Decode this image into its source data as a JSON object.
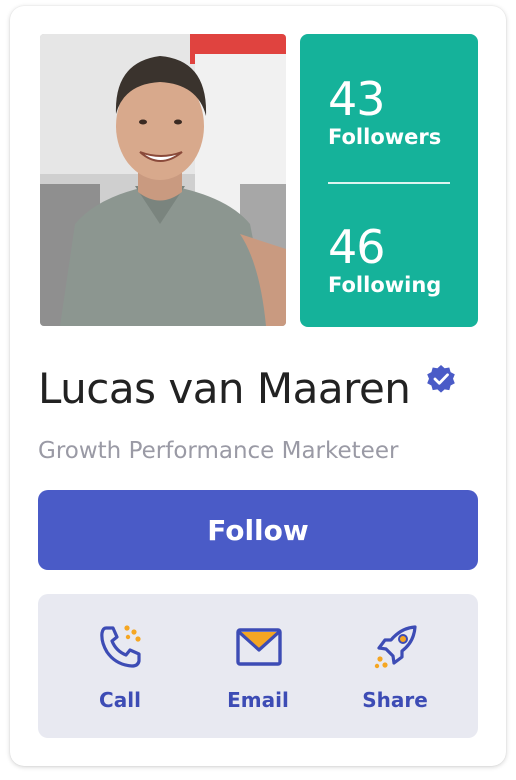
{
  "profile": {
    "photo_alt": "Profile photo",
    "name": "Lucas van Maaren",
    "verified": true,
    "title": "Growth Performance Marketeer"
  },
  "stats": {
    "followers_count": "43",
    "followers_label": "Followers",
    "following_count": "46",
    "following_label": "Following"
  },
  "follow_button": {
    "label": "Follow"
  },
  "actions": [
    {
      "label": "Call",
      "icon": "phone-icon"
    },
    {
      "label": "Email",
      "icon": "envelope-icon"
    },
    {
      "label": "Share",
      "icon": "rocket-icon"
    }
  ],
  "colors": {
    "stats_bg": "#15b29a",
    "primary": "#4a5bc7",
    "action_text": "#3d4cb5",
    "accent_orange": "#f5a623",
    "actions_bg": "#e8e9f1"
  }
}
